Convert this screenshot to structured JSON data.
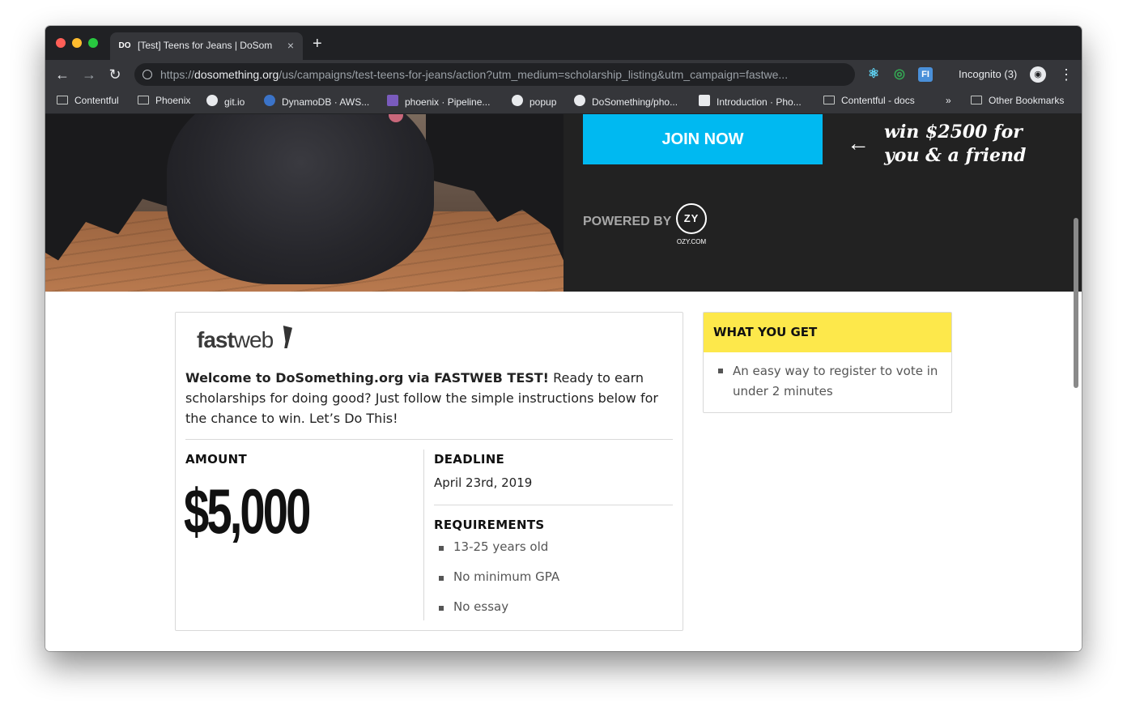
{
  "browser": {
    "tab_title": "[Test] Teens for Jeans | DoSom",
    "tab_favicon": "DO",
    "new_tab": "+",
    "close_tab": "×",
    "url_scheme": "https://",
    "url_host": "dosomething.org",
    "url_path": "/us/campaigns/test-teens-for-jeans/action?utm_medium=scholarship_listing&utm_campaign=fastwe...",
    "incognito_label": "Incognito (3)",
    "nav": {
      "back": "←",
      "forward": "→",
      "reload": "↻",
      "menu": "⋮"
    },
    "extensions": [
      {
        "icon": "react-icon",
        "glyph": "⚛",
        "color": "#61dafb"
      },
      {
        "icon": "target-icon",
        "glyph": "◎",
        "color": "#34a853"
      },
      {
        "icon": "fi-icon",
        "glyph": "FI",
        "color": "#4a90d9"
      }
    ]
  },
  "bookmarks": [
    {
      "label": "Contentful",
      "icon": "folder-icon"
    },
    {
      "label": "Phoenix",
      "icon": "folder-icon"
    },
    {
      "label": "git.io",
      "icon": "github-icon"
    },
    {
      "label": "DynamoDB · AWS...",
      "icon": "dynamodb-icon"
    },
    {
      "label": "phoenix · Pipeline...",
      "icon": "heroku-icon"
    },
    {
      "label": "popup",
      "icon": "globe-icon"
    },
    {
      "label": "DoSomething/pho...",
      "icon": "github-icon"
    },
    {
      "label": "Introduction · Pho...",
      "icon": "dosomething-icon"
    },
    {
      "label": "Contentful - docs",
      "icon": "folder-icon"
    },
    {
      "label": "»",
      "icon": ""
    },
    {
      "label": "Other Bookmarks",
      "icon": "folder-icon"
    }
  ],
  "hero": {
    "join_label": "JOIN NOW",
    "arrow": "←",
    "handwritten": "win $2500 for you & a friend",
    "powered_by": "POWERED BY",
    "ozy_logo": "ZY",
    "ozy_domain": "OZY.COM",
    "accent": "#00b9f1"
  },
  "scholarship": {
    "logo_fast": "fast",
    "logo_web": "web",
    "intro_bold": "Welcome to DoSomething.org via FASTWEB TEST!",
    "intro_rest": " Ready to earn scholarships for doing good? Just follow the simple instructions below for the chance to win. Let’s Do This!",
    "amount_label": "AMOUNT",
    "amount": "$5,000",
    "deadline_label": "DEADLINE",
    "deadline": "April 23rd, 2019",
    "requirements_label": "REQUIREMENTS",
    "requirements": [
      "13-25 years old",
      "No minimum GPA",
      "No essay"
    ]
  },
  "what_you_get": {
    "title": "WHAT YOU GET",
    "item": "An easy way to register to vote in under 2 minutes",
    "header_color": "#fde84b"
  }
}
